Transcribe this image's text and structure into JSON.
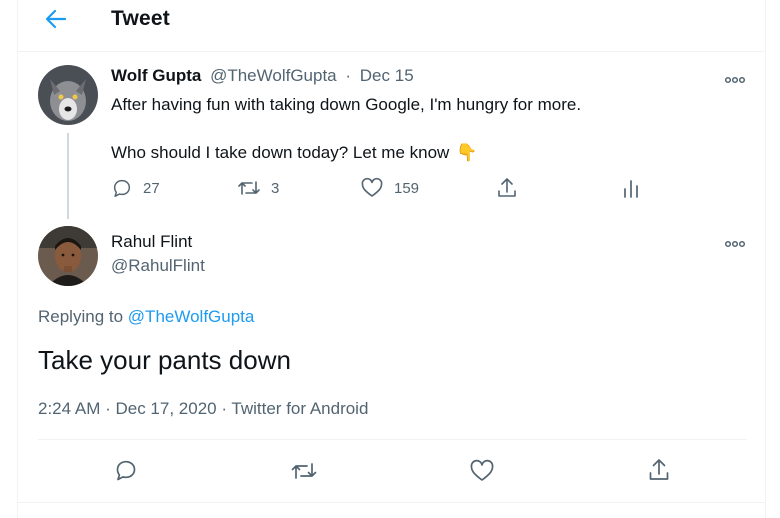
{
  "header": {
    "title": "Tweet"
  },
  "parent_tweet": {
    "author_name": "Wolf Gupta",
    "handle": "@TheWolfGupta",
    "separator": "·",
    "date": "Dec 15",
    "text_line1": "After having fun with taking down Google, I'm hungry for more.",
    "text_line2": "Who should I take down today? Let me know",
    "emoji": "👇",
    "replies": "27",
    "retweets": "3",
    "likes": "159"
  },
  "main_tweet": {
    "author_name": "Rahul Flint",
    "handle": "@RahulFlint",
    "replying_prefix": "Replying to",
    "replying_handle": "@TheWolfGupta",
    "text": "Take your pants down",
    "timestamp": "2:24 AM · Dec 17, 2020 · Twitter for Android"
  },
  "colors": {
    "accent": "#1d9bf0",
    "muted": "#536471",
    "emoji": "#f5b829"
  }
}
